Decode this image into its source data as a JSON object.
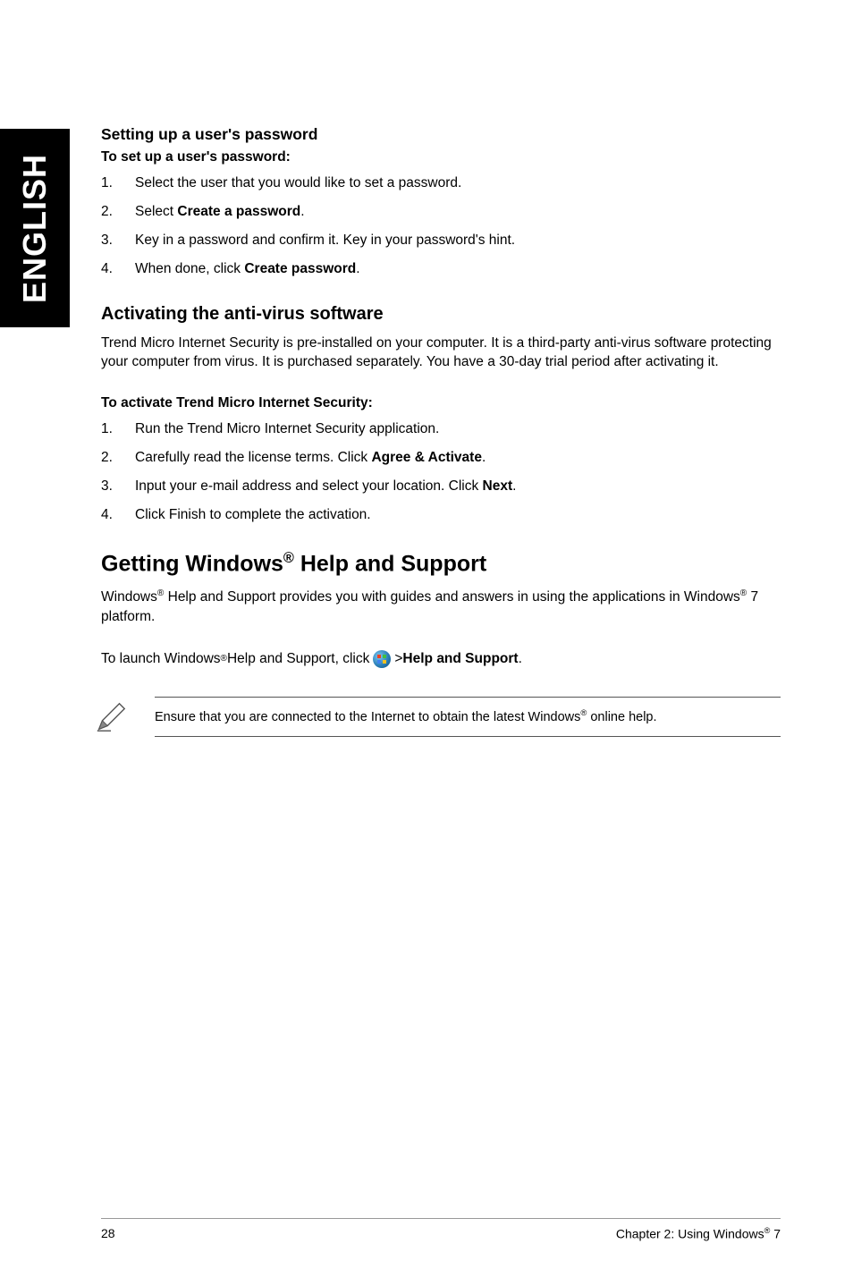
{
  "side_tab": "ENGLISH",
  "section1": {
    "heading": "Setting up a user's password",
    "lead": "To set up a user's password:",
    "steps": [
      {
        "n": "1.",
        "t_before": "Select the user that you would like to set a password.",
        "bold": "",
        "t_after": ""
      },
      {
        "n": "2.",
        "t_before": "Select ",
        "bold": "Create a password",
        "t_after": "."
      },
      {
        "n": "3.",
        "t_before": "Key in a password and confirm it. Key in your password's hint.",
        "bold": "",
        "t_after": ""
      },
      {
        "n": "4.",
        "t_before": "When done, click ",
        "bold": "Create password",
        "t_after": "."
      }
    ]
  },
  "section2": {
    "heading": "Activating the anti-virus software",
    "para": "Trend Micro Internet Security is pre-installed on your computer. It is a third-party anti-virus software protecting your computer from virus. It is purchased separately. You have a 30-day trial period after activating it.",
    "lead": "To activate Trend Micro Internet Security:",
    "steps": [
      {
        "n": "1.",
        "t_before": "Run the Trend Micro Internet Security application.",
        "bold": "",
        "t_after": ""
      },
      {
        "n": "2.",
        "t_before": "Carefully read the license terms. Click ",
        "bold": "Agree & Activate",
        "t_after": "."
      },
      {
        "n": "3.",
        "t_before": "Input your e-mail address and select your location. Click ",
        "bold": "Next",
        "t_after": "."
      },
      {
        "n": "4.",
        "t_before": "Click Finish to complete the activation.",
        "bold": "",
        "t_after": ""
      }
    ]
  },
  "section3": {
    "heading_before": "Getting Windows",
    "heading_sup": "®",
    "heading_after": " Help and Support",
    "para_a": "Windows",
    "para_b": " Help and Support provides you with guides and answers in using the applications in Windows",
    "para_c": " 7 platform.",
    "launch_a": "To launch Windows",
    "launch_b": " Help and Support, click ",
    "launch_c": " > ",
    "launch_bold": "Help and Support",
    "launch_d": ".",
    "note_a": "Ensure that you are connected to the Internet to obtain the latest Windows",
    "note_b": " online help."
  },
  "footer": {
    "page": "28",
    "chapter_a": "Chapter 2: Using Windows",
    "chapter_b": " 7",
    "sup": "®"
  }
}
